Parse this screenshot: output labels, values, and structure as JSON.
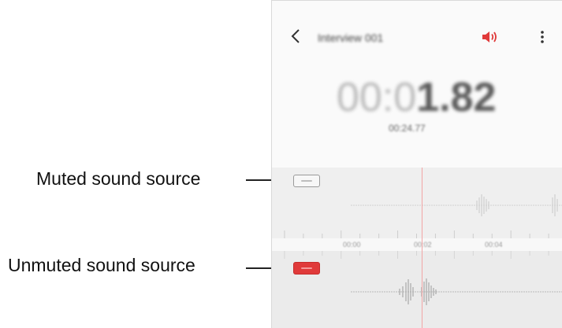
{
  "callouts": {
    "muted": "Muted sound source",
    "unmuted": "Unmuted sound source"
  },
  "app": {
    "title": "Interview 001",
    "timer_dim": "00:0",
    "timer_main": "1.82",
    "duration": "00:24.77",
    "ruler_labels": [
      "00:00",
      "00:02",
      "00:04"
    ]
  },
  "icons": {
    "back": "back-arrow-icon",
    "speaker": "speaker-icon",
    "more": "more-options-icon"
  },
  "colors": {
    "accent": "#e03a3a",
    "playhead": "#f2a5a5"
  }
}
